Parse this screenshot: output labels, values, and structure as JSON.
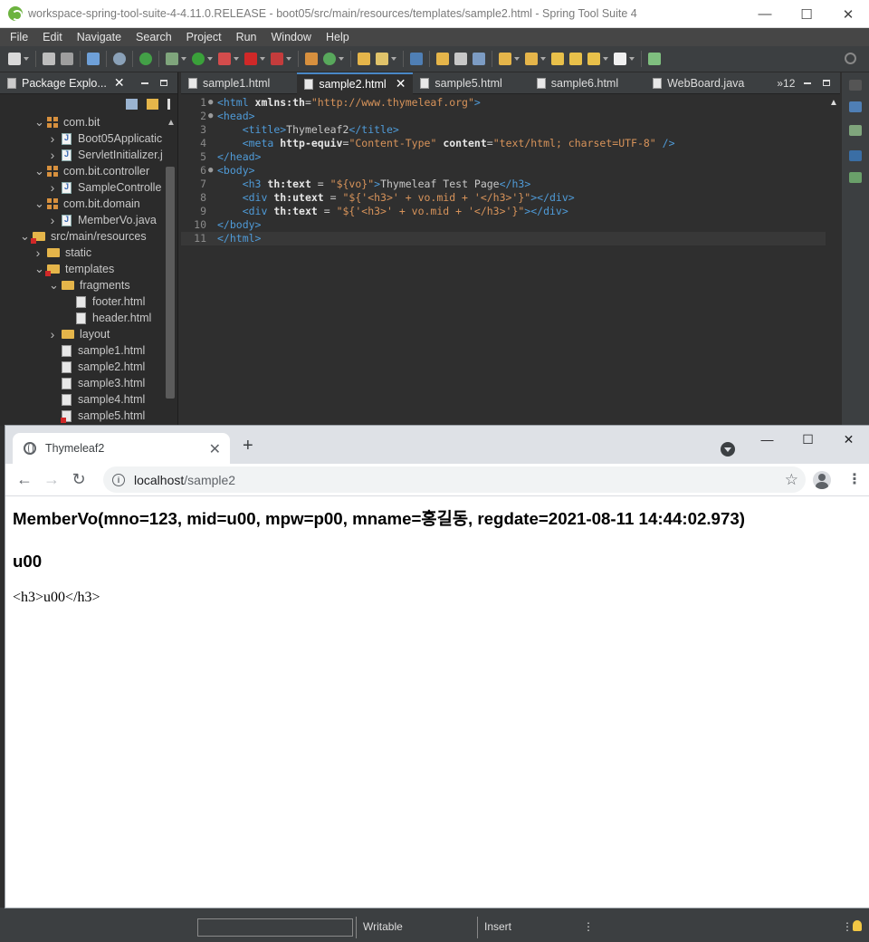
{
  "ide": {
    "title": "workspace-spring-tool-suite-4-4.11.0.RELEASE - boot05/src/main/resources/templates/sample2.html - Spring Tool Suite 4",
    "menu": [
      "File",
      "Edit",
      "Navigate",
      "Search",
      "Project",
      "Run",
      "Window",
      "Help"
    ],
    "package_explorer": {
      "tab_label": "Package Explo...",
      "tree": [
        {
          "label": "com.bit",
          "type": "package",
          "indent": 1,
          "chev": "v"
        },
        {
          "label": "Boot05Applicatic",
          "type": "java",
          "indent": 2,
          "chev": ">"
        },
        {
          "label": "ServletInitializer.j",
          "type": "java",
          "indent": 2,
          "chev": ">"
        },
        {
          "label": "com.bit.controller",
          "type": "package",
          "indent": 1,
          "chev": "v"
        },
        {
          "label": "SampleControlle",
          "type": "java",
          "indent": 2,
          "chev": ">"
        },
        {
          "label": "com.bit.domain",
          "type": "package",
          "indent": 1,
          "chev": "v"
        },
        {
          "label": "MemberVo.java",
          "type": "java",
          "indent": 2,
          "chev": ">"
        },
        {
          "label": "src/main/resources",
          "type": "folder-err",
          "indent": 0,
          "chev": "v"
        },
        {
          "label": "static",
          "type": "folder",
          "indent": 1,
          "chev": ">"
        },
        {
          "label": "templates",
          "type": "folder-err",
          "indent": 1,
          "chev": "v"
        },
        {
          "label": "fragments",
          "type": "folder",
          "indent": 2,
          "chev": "v"
        },
        {
          "label": "footer.html",
          "type": "html",
          "indent": 3,
          "chev": ""
        },
        {
          "label": "header.html",
          "type": "html",
          "indent": 3,
          "chev": ""
        },
        {
          "label": "layout",
          "type": "folder",
          "indent": 2,
          "chev": ">"
        },
        {
          "label": "sample1.html",
          "type": "html",
          "indent": 2,
          "chev": ""
        },
        {
          "label": "sample2.html",
          "type": "html",
          "indent": 2,
          "chev": ""
        },
        {
          "label": "sample3.html",
          "type": "html",
          "indent": 2,
          "chev": ""
        },
        {
          "label": "sample4.html",
          "type": "html",
          "indent": 2,
          "chev": ""
        },
        {
          "label": "sample5.html",
          "type": "html-err",
          "indent": 2,
          "chev": ""
        }
      ]
    },
    "editor": {
      "tabs": [
        {
          "label": "sample1.html",
          "active": false
        },
        {
          "label": "sample2.html",
          "active": true
        },
        {
          "label": "sample5.html",
          "active": false
        },
        {
          "label": "sample6.html",
          "active": false
        },
        {
          "label": "WebBoard.java",
          "active": false
        }
      ],
      "more_tabs": "»12",
      "lines": [
        {
          "n": "1",
          "fold": "⊖",
          "parts": [
            [
              "t-tag",
              "<html "
            ],
            [
              "t-attr",
              "xmlns:th"
            ],
            [
              "t-txt",
              "="
            ],
            [
              "t-val",
              "\"http://www.thymeleaf.org\""
            ],
            [
              "t-tag",
              ">"
            ]
          ]
        },
        {
          "n": "2",
          "fold": "⊖",
          "parts": [
            [
              "t-tag",
              "<head>"
            ]
          ]
        },
        {
          "n": "3",
          "fold": "",
          "parts": [
            [
              "t-txt",
              "    "
            ],
            [
              "t-tag",
              "<title>"
            ],
            [
              "t-txt",
              "Thymeleaf2"
            ],
            [
              "t-tag",
              "</title>"
            ]
          ]
        },
        {
          "n": "4",
          "fold": "",
          "parts": [
            [
              "t-txt",
              "    "
            ],
            [
              "t-tag",
              "<meta "
            ],
            [
              "t-attr",
              "http-equiv"
            ],
            [
              "t-txt",
              "="
            ],
            [
              "t-val",
              "\"Content-Type\""
            ],
            [
              "t-txt",
              " "
            ],
            [
              "t-attr",
              "content"
            ],
            [
              "t-txt",
              "="
            ],
            [
              "t-val",
              "\"text/html; charset=UTF-8\""
            ],
            [
              "t-tag",
              " />"
            ]
          ]
        },
        {
          "n": "5",
          "fold": "",
          "parts": [
            [
              "t-tag",
              "</head>"
            ]
          ]
        },
        {
          "n": "6",
          "fold": "⊖",
          "parts": [
            [
              "t-tag",
              "<body>"
            ]
          ]
        },
        {
          "n": "7",
          "fold": "",
          "parts": [
            [
              "t-txt",
              "    "
            ],
            [
              "t-tag",
              "<h3 "
            ],
            [
              "t-attr",
              "th:text"
            ],
            [
              "t-txt",
              " = "
            ],
            [
              "t-val",
              "\"${vo}\""
            ],
            [
              "t-tag",
              ">"
            ],
            [
              "t-txt",
              "Thymeleaf Test Page"
            ],
            [
              "t-tag",
              "</h3>"
            ]
          ]
        },
        {
          "n": "8",
          "fold": "",
          "parts": [
            [
              "t-txt",
              "    "
            ],
            [
              "t-tag",
              "<div "
            ],
            [
              "t-attr",
              "th:utext"
            ],
            [
              "t-txt",
              " = "
            ],
            [
              "t-val",
              "\"${'<h3>' + vo.mid + '</h3>'}\""
            ],
            [
              "t-tag",
              "></div>"
            ]
          ]
        },
        {
          "n": "9",
          "fold": "",
          "parts": [
            [
              "t-txt",
              "    "
            ],
            [
              "t-tag",
              "<div "
            ],
            [
              "t-attr",
              "th:text"
            ],
            [
              "t-txt",
              " = "
            ],
            [
              "t-val",
              "\"${'<h3>' + vo.mid + '</h3>'}\""
            ],
            [
              "t-tag",
              "></div>"
            ]
          ]
        },
        {
          "n": "10",
          "fold": "",
          "parts": [
            [
              "t-tag",
              "</body>"
            ]
          ]
        },
        {
          "n": "11",
          "fold": "",
          "parts": [
            [
              "t-tag",
              "</html>"
            ]
          ],
          "current": true
        }
      ]
    },
    "status": {
      "writable": "Writable",
      "insert": "Insert"
    }
  },
  "browser": {
    "tab_title": "Thymeleaf2",
    "url_host": "localhost",
    "url_path": "/sample2",
    "content": {
      "h3_vo": "MemberVo(mno=123, mid=u00, mpw=p00, mname=홍길동, regdate=2021-08-11 14:44:02.973)",
      "h3_mid": "u00",
      "raw_text": "<h3>u00</h3>"
    }
  },
  "colors": {
    "ide_bg": "#2f2f2f",
    "keyword_tag": "#4f9bd8",
    "string_value": "#d7935a",
    "active_tab_accent": "#4a88c7"
  }
}
